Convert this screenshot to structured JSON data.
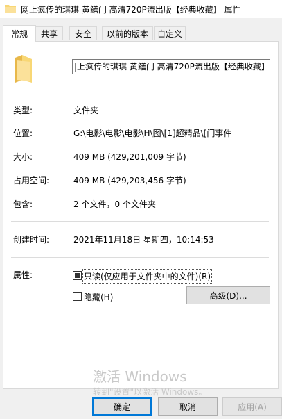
{
  "window": {
    "title": "网上疯传的琪琪 黄鳝门 高清720P流出版【经典收藏】 属性",
    "icon": "folder-icon"
  },
  "tabs": [
    {
      "label": "常规",
      "active": true
    },
    {
      "label": "共享",
      "active": false
    },
    {
      "label": "安全",
      "active": false
    },
    {
      "label": "以前的版本",
      "active": false
    },
    {
      "label": "自定义",
      "active": false
    }
  ],
  "folder_name": "|上疯传的琪琪 黄鳝门 高清720P流出版【经典收藏】",
  "info": {
    "type_label": "类型:",
    "type_value": "文件夹",
    "location_label": "位置:",
    "location_value": "G:\\电影\\电影\\电影\\H\\图\\[1]超精品\\[门事件",
    "size_label": "大小:",
    "size_value": "409 MB (429,201,009 字节)",
    "disk_label": "占用空间:",
    "disk_value": "409 MB (429,203,456 字节)",
    "contains_label": "包含:",
    "contains_value": "2 个文件，0 个文件夹",
    "created_label": "创建时间:",
    "created_value": "2021年11月18日 星期四，10:14:53"
  },
  "attributes": {
    "label": "属性:",
    "readonly_label": "只读(仅应用于文件夹中的文件)(R)",
    "readonly_state": "indeterminate",
    "hidden_label": "隐藏(H)",
    "hidden_state": "unchecked",
    "advanced_label": "高级(D)..."
  },
  "buttons": {
    "ok": "确定",
    "cancel": "取消",
    "apply": "应用(A)"
  },
  "watermark": {
    "line1": "激活 Windows",
    "line2": "转到\"设置\"以激活 Windows。"
  },
  "colors": {
    "accent": "#0078d7",
    "folder": "#f8d775"
  }
}
